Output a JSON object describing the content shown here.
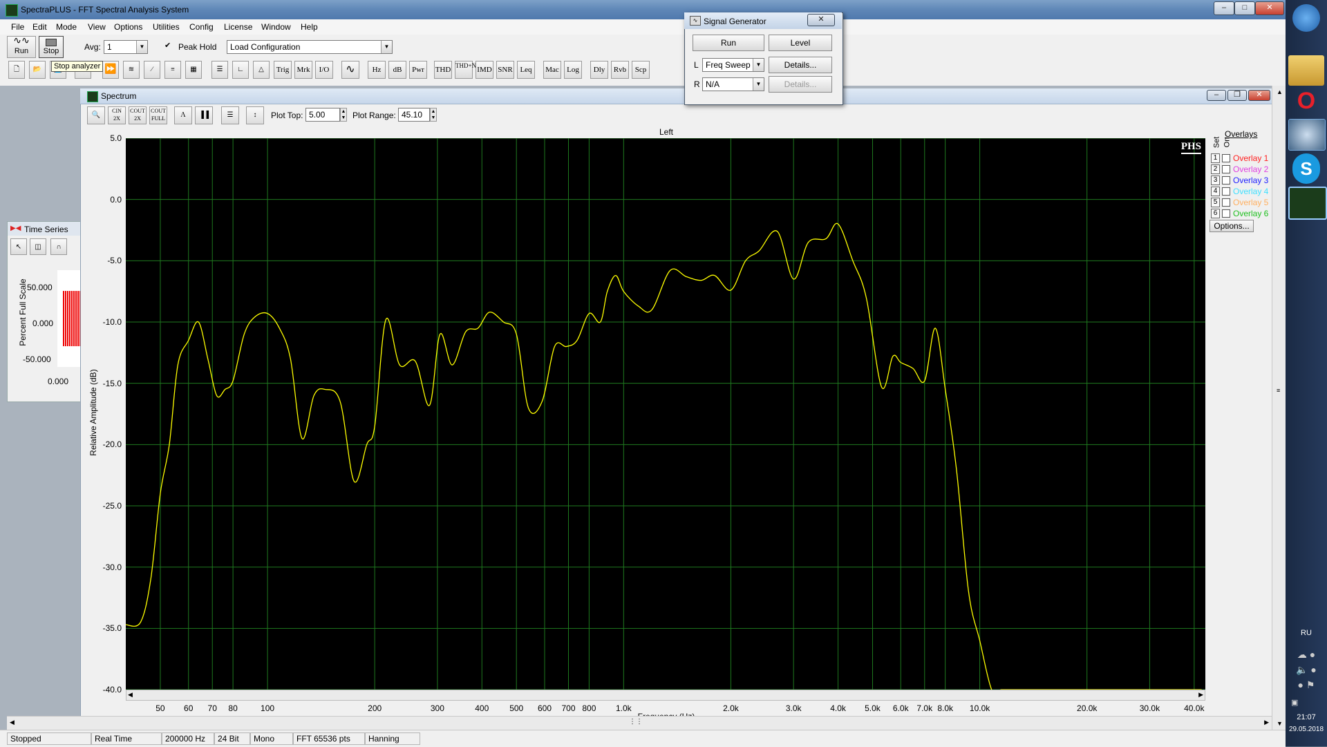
{
  "app": {
    "title": "SpectraPLUS - FFT Spectral Analysis System"
  },
  "menu": [
    "File",
    "Edit",
    "Mode",
    "View",
    "Options",
    "Utilities",
    "Config",
    "License",
    "Window",
    "Help"
  ],
  "toolbar1": {
    "run_label": "Run",
    "stop_label": "Stop",
    "avg_label": "Avg:",
    "avg_value": "1",
    "peak_hold_label": "Peak Hold",
    "peak_hold_checked": true,
    "config_value": "Load Configuration",
    "tooltip": "Stop analyzer"
  },
  "toolbar2": [
    "Trig",
    "Mrk",
    "I/O",
    "Hz",
    "dB",
    "Pwr",
    "THD",
    "THD+N",
    "IMD",
    "SNR",
    "Leq",
    "Mac",
    "Log",
    "Dly",
    "Rvb",
    "Scp"
  ],
  "timeseries": {
    "title": "Time Series",
    "ylabel": "Percent Full Scale",
    "ticks": [
      "50.000",
      "0.000",
      "-50.000",
      "0.000"
    ]
  },
  "spectrum": {
    "title": "Spectrum",
    "plot_top_label": "Plot Top:",
    "plot_top_value": "5.00",
    "plot_range_label": "Plot Range:",
    "plot_range_value": "45.10",
    "channel_label": "Left",
    "logo": "PHS",
    "ylabel": "Relative Amplitude (dB)",
    "xlabel": "Frequency (Hz)",
    "overlays_label": "Overlays",
    "set_label": "Set",
    "on_label": "On",
    "overlays": [
      {
        "num": "1",
        "name": "Overlay 1",
        "color": "#ff2020"
      },
      {
        "num": "2",
        "name": "Overlay 2",
        "color": "#e040e0"
      },
      {
        "num": "3",
        "name": "Overlay 3",
        "color": "#2020ff"
      },
      {
        "num": "4",
        "name": "Overlay 4",
        "color": "#40e0ff"
      },
      {
        "num": "5",
        "name": "Overlay 5",
        "color": "#ffb060"
      },
      {
        "num": "6",
        "name": "Overlay 6",
        "color": "#20c020"
      }
    ],
    "options_label": "Options..."
  },
  "chart_data": {
    "type": "line",
    "title": "Left",
    "xlabel": "Frequency (Hz)",
    "ylabel": "Relative Amplitude (dB)",
    "xscale": "log",
    "xlim": [
      40,
      43000
    ],
    "ylim": [
      -40,
      5
    ],
    "yticks": [
      "5.0",
      "0.0",
      "-5.0",
      "-10.0",
      "-15.0",
      "-20.0",
      "-25.0",
      "-30.0",
      "-35.0",
      "-40.0"
    ],
    "xticks": [
      {
        "v": 50,
        "label": "50"
      },
      {
        "v": 60,
        "label": "60"
      },
      {
        "v": 70,
        "label": "70"
      },
      {
        "v": 80,
        "label": "80"
      },
      {
        "v": 100,
        "label": "100"
      },
      {
        "v": 200,
        "label": "200"
      },
      {
        "v": 300,
        "label": "300"
      },
      {
        "v": 400,
        "label": "400"
      },
      {
        "v": 500,
        "label": "500"
      },
      {
        "v": 600,
        "label": "600"
      },
      {
        "v": 700,
        "label": "700"
      },
      {
        "v": 800,
        "label": "800"
      },
      {
        "v": 1000,
        "label": "1.0k"
      },
      {
        "v": 2000,
        "label": "2.0k"
      },
      {
        "v": 3000,
        "label": "3.0k"
      },
      {
        "v": 4000,
        "label": "4.0k"
      },
      {
        "v": 5000,
        "label": "5.0k"
      },
      {
        "v": 6000,
        "label": "6.0k"
      },
      {
        "v": 7000,
        "label": "7.0k"
      },
      {
        "v": 8000,
        "label": "8.0k"
      },
      {
        "v": 10000,
        "label": "10.0k"
      },
      {
        "v": 20000,
        "label": "20.0k"
      },
      {
        "v": 30000,
        "label": "30.0k"
      },
      {
        "v": 40000,
        "label": "40.0k"
      }
    ],
    "grid": true,
    "series": [
      {
        "color": "#ffff00",
        "x": [
          40,
          44,
          47,
          50,
          53,
          56,
          60,
          64,
          68,
          72,
          76,
          80,
          86,
          92,
          100,
          108,
          116,
          125,
          135,
          145,
          160,
          175,
          190,
          200,
          215,
          235,
          260,
          285,
          305,
          330,
          360,
          390,
          420,
          460,
          500,
          540,
          590,
          640,
          690,
          740,
          800,
          860,
          900,
          950,
          1000,
          1100,
          1200,
          1350,
          1500,
          1650,
          1800,
          2000,
          2200,
          2400,
          2700,
          3000,
          3300,
          3700,
          4000,
          4400,
          4800,
          5300,
          5700,
          6000,
          6500,
          7000,
          7500,
          8000,
          8600,
          9300,
          10000,
          10800,
          11500,
          12500,
          13500,
          15000,
          16500,
          18000,
          19500,
          20500,
          21500,
          22500,
          24000,
          25500,
          27000,
          28500,
          30000,
          31500,
          33000,
          35000,
          40000,
          42000
        ],
        "y": [
          -34.7,
          -34.5,
          -31,
          -24,
          -20,
          -13.5,
          -11.5,
          -10,
          -13,
          -16,
          -15.5,
          -14.8,
          -11,
          -9.6,
          -9.3,
          -10.5,
          -13,
          -19.5,
          -16,
          -15.5,
          -16.5,
          -23,
          -20,
          -18.5,
          -9.8,
          -13.5,
          -13.2,
          -16.8,
          -11,
          -13.5,
          -10.8,
          -10.5,
          -9.2,
          -10,
          -11,
          -17,
          -16.5,
          -12,
          -12,
          -11.5,
          -9.3,
          -10,
          -7.5,
          -6.2,
          -7.5,
          -8.7,
          -9,
          -5.8,
          -6.3,
          -6.6,
          -6.2,
          -7.4,
          -5,
          -4.2,
          -2.6,
          -6.5,
          -3.5,
          -3.2,
          -2,
          -5,
          -8,
          -15.3,
          -12.8,
          -13.3,
          -13.8,
          -14.8,
          -10.5,
          -15.5,
          -22,
          -32,
          -36,
          -40,
          -40,
          -40,
          -40,
          -40,
          -40,
          -40,
          -40,
          -40,
          -40,
          -40,
          -40,
          -40,
          -40,
          -40,
          -40,
          -40,
          -40,
          -40,
          -40,
          -40
        ]
      }
    ]
  },
  "siggen": {
    "title": "Signal Generator",
    "run_label": "Run",
    "level_label": "Level",
    "l_label": "L",
    "l_value": "Freq Sweep",
    "r_label": "R",
    "r_value": "N/A",
    "details_label": "Details...",
    "details2_label": "Details..."
  },
  "status": [
    "Stopped",
    "Real Time",
    "200000 Hz",
    "24 Bit",
    "Mono",
    "FFT 65536 pts",
    "Hanning"
  ],
  "tray": {
    "lang": "RU",
    "time": "21:07",
    "date": "29.05.2018"
  }
}
